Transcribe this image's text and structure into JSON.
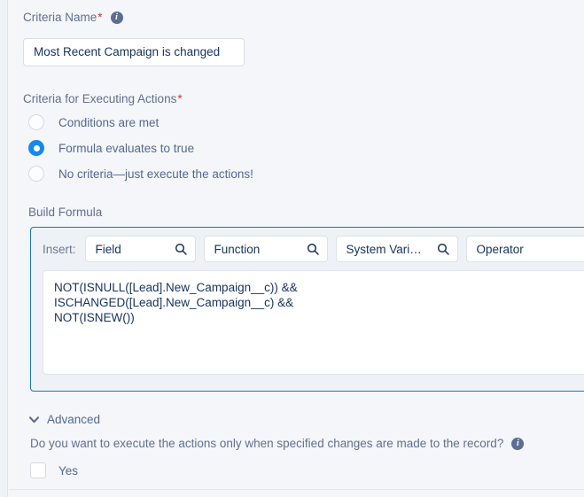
{
  "criteria_name": {
    "label": "Criteria Name",
    "required_mark": "*",
    "info_icon": "info-icon",
    "info_glyph": "i",
    "value": "Most Recent Campaign is changed"
  },
  "criteria_for_executing_actions": {
    "label": "Criteria for Executing Actions",
    "required_mark": "*",
    "options": [
      {
        "label": "Conditions are met",
        "selected": false
      },
      {
        "label": "Formula evaluates to true",
        "selected": true
      },
      {
        "label": "No criteria—just execute the actions!",
        "selected": false
      }
    ]
  },
  "build_formula": {
    "label": "Build Formula",
    "insert_label": "Insert:",
    "pickers": [
      {
        "label": "Field",
        "icon": "search-icon"
      },
      {
        "label": "Function",
        "icon": "search-icon"
      },
      {
        "label": "System Vari…",
        "icon": "search-icon"
      },
      {
        "label": "Operator",
        "icon": "search-icon"
      }
    ],
    "formula_text": "NOT(ISNULL([Lead].New_Campaign__c)) &&\nISCHANGED([Lead].New_Campaign__c) &&\nNOT(ISNEW())"
  },
  "advanced": {
    "label": "Advanced",
    "toggle_icon": "chevron-down-icon",
    "description": "Do you want to execute the actions only when specified changes are made to the record?",
    "info_icon": "info-icon",
    "info_glyph": "i",
    "checkbox": {
      "label": "Yes",
      "checked": false
    }
  },
  "colors": {
    "page_background": "#f4f6f9",
    "accent_blue": "#1589ee",
    "focus_border": "#1b75bb",
    "label_text": "#61708c",
    "value_text": "#16325c",
    "required_star": "#c23934",
    "info_icon_fill": "#5b6e92"
  }
}
